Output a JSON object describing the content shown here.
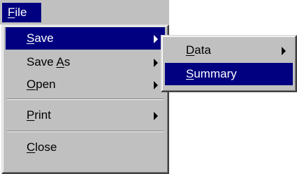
{
  "menubar": {
    "file": {
      "label": "File",
      "mnemonic": "F"
    }
  },
  "file_menu": {
    "items": [
      {
        "label": "Save",
        "mnemonic": "S",
        "state": "highlighted",
        "has_submenu": true
      },
      {
        "label": "Save As",
        "mnemonic": "A",
        "has_submenu": true
      },
      {
        "label": "Open",
        "mnemonic": "O",
        "has_submenu": true
      },
      {
        "label": "Print",
        "mnemonic": "P",
        "has_submenu": true
      },
      {
        "label": "Close",
        "mnemonic": "C",
        "has_submenu": false
      }
    ]
  },
  "save_submenu": {
    "items": [
      {
        "label": "Data",
        "mnemonic": "D",
        "has_submenu": true
      },
      {
        "label": "Summary",
        "mnemonic": "S",
        "state": "highlighted",
        "has_submenu": false
      }
    ]
  },
  "colors": {
    "menu_bg": "#c0c0c0",
    "highlight_bg": "#000080",
    "highlight_text": "#ffffff"
  },
  "icons": [
    "submenu-arrow-icon"
  ]
}
